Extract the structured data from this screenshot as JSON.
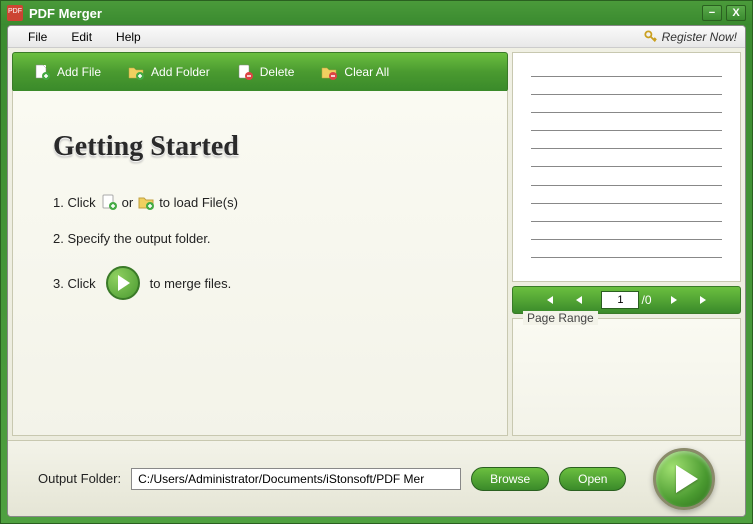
{
  "window": {
    "title": "PDF Merger"
  },
  "menu": {
    "file": "File",
    "edit": "Edit",
    "help": "Help",
    "register": "Register  Now!"
  },
  "toolbar": {
    "add_file": "Add File",
    "add_folder": "Add Folder",
    "delete": "Delete",
    "clear_all": "Clear All"
  },
  "getting_started": {
    "heading": "Getting Started",
    "step1_a": "1. Click",
    "step1_b": "or",
    "step1_c": "to load File(s)",
    "step2": "2. Specify the output folder.",
    "step3_a": "3. Click",
    "step3_b": "to  merge files."
  },
  "pager": {
    "current": "1",
    "total": "/0"
  },
  "page_range": {
    "label": "Page Range"
  },
  "footer": {
    "label": "Output Folder:",
    "path": "C:/Users/Administrator/Documents/iStonsoft/PDF Mer",
    "browse": "Browse",
    "open": "Open"
  }
}
